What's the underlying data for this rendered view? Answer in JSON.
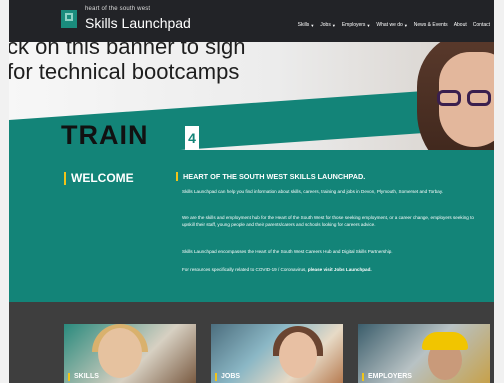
{
  "header": {
    "logo_small": "heart of the south west",
    "logo_big": "Skills Launchpad",
    "nav": [
      {
        "label": "Skills",
        "dropdown": true
      },
      {
        "label": "Jobs",
        "dropdown": true
      },
      {
        "label": "Employers",
        "dropdown": true
      },
      {
        "label": "What we do",
        "dropdown": true
      },
      {
        "label": "News & Events",
        "dropdown": false
      },
      {
        "label": "About",
        "dropdown": false
      },
      {
        "label": "Contact",
        "dropdown": false
      }
    ]
  },
  "hero": {
    "banner_line1": "ck on this banner to sign",
    "banner_line2": "for technical bootcamps",
    "train_text": "TRAIN",
    "train_num": "4"
  },
  "welcome": {
    "heading": "WELCOME",
    "intro_heading": "HEART OF THE SOUTH WEST SKILLS LAUNCHPAD.",
    "para1": "Skills Launchpad can help you find information about skills, careers, training and jobs in Devon, Plymouth, Somerset and Torbay.",
    "para2": "We are the skills and employment hub for the Heart of the South West for those seeking employment, or a career change, employers seeking to upskill their staff, young people and their parents/carers and schools looking for careers advice.",
    "para3": "Skills Launchpad encompasses the Heart of the South West Careers Hub and Digital Skills Partnership.",
    "para4_text": "For resources specifically related to COVID-19 / Coronavirus,",
    "para4_link": "please visit Jobs Launchpad."
  },
  "cards": [
    {
      "label": "SKILLS"
    },
    {
      "label": "JOBS"
    },
    {
      "label": "EMPLOYERS"
    }
  ],
  "colors": {
    "teal": "#138478",
    "header": "#222327",
    "accent": "#f0c419",
    "footer": "#3e3e3e"
  }
}
